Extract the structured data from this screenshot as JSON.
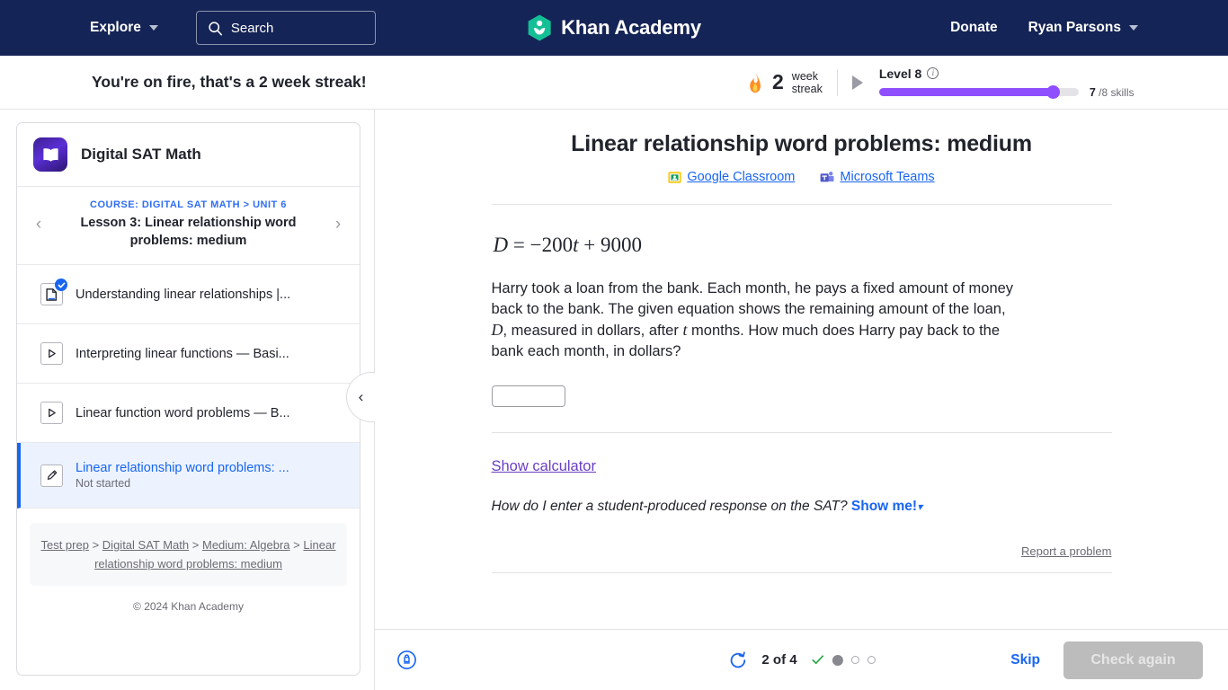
{
  "topnav": {
    "explore_label": "Explore",
    "search_placeholder": "Search",
    "brand_name": "Khan Academy",
    "donate_label": "Donate",
    "user_name": "Ryan Parsons"
  },
  "streakbar": {
    "message": "You're on fire, that's a 2 week streak!",
    "streak_number": "2",
    "streak_line1": "week",
    "streak_line2": "streak",
    "level_label": "Level 8",
    "progress_percent": 87,
    "skills_done": "7",
    "skills_total": "/8 skills"
  },
  "sidebar": {
    "course_title": "Digital SAT Math",
    "course_crumb": "COURSE: DIGITAL SAT MATH > UNIT 6",
    "lesson_name": "Lesson 3: Linear relationship word problems: medium",
    "prev_label": "‹",
    "next_label": "›",
    "items": [
      {
        "title": "Understanding linear relationships |...",
        "icon": "article-icon",
        "completed": true,
        "sub": ""
      },
      {
        "title": "Interpreting linear functions — Basi...",
        "icon": "video-icon",
        "completed": false,
        "sub": ""
      },
      {
        "title": "Linear function word problems — B...",
        "icon": "video-icon",
        "completed": false,
        "sub": ""
      },
      {
        "title": "Linear relationship word problems: ...",
        "icon": "exercise-icon",
        "completed": false,
        "sub": "Not started",
        "active": true
      }
    ],
    "breadcrumb": {
      "l1": "Test prep",
      "sep": ">",
      "l2": "Digital SAT Math",
      "l3": "Medium: Algebra",
      "l4": "Linear relationship word problems: medium"
    },
    "copyright": "© 2024 Khan Academy",
    "collapse_label": "‹"
  },
  "exercise": {
    "title": "Linear relationship word problems: medium",
    "google_classroom": "Google Classroom",
    "microsoft_teams": "Microsoft Teams",
    "equation": "D = −200t + 9000",
    "equation_parts": {
      "var_d": "D",
      "rest": "= −200",
      "var_t": "t",
      "tail": "+ 9000"
    },
    "problem_part1": "Harry took a loan from the bank. Each month, he pays a fixed amount of money back to the bank. The given equation shows the remaining amount of the loan, ",
    "problem_var_d": "D",
    "problem_part2": ", measured in dollars, after ",
    "problem_var_t": "t",
    "problem_part3": " months. How much does Harry pay back to the bank each month, in dollars?",
    "answer_value": "",
    "answer_placeholder": "",
    "show_calculator": "Show calculator",
    "howto_question": "How do I enter a student-produced response on the SAT?",
    "howto_cta": "Show me!",
    "report_label": "Report a problem"
  },
  "bottombar": {
    "progress_count": "2 of 4",
    "skip_label": "Skip",
    "check_label": "Check again",
    "dots": [
      "check",
      "filled",
      "empty",
      "empty"
    ]
  },
  "colors": {
    "nav_bg": "#152456",
    "brand_green": "#14bf96",
    "link_blue": "#1865f2",
    "purple": "#8f4fff",
    "calc_purple": "#6b3fc4"
  }
}
